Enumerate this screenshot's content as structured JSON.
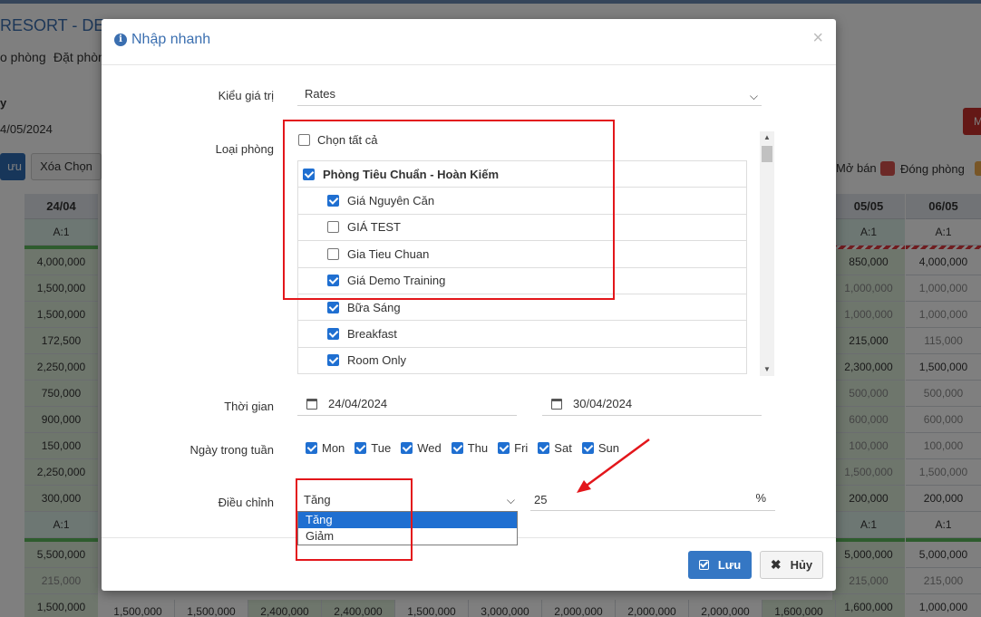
{
  "app": {
    "title": "RESORT - DEM",
    "nav": [
      "o phòng",
      "Đặt phòn"
    ],
    "filter_label": "y",
    "filter_date": "4/05/2024",
    "save_button": "ưu",
    "clear_button": "Xóa Chọn",
    "legend": [
      {
        "label": "Mở bán",
        "color": "#ffffff"
      },
      {
        "label": "Đóng phòng",
        "color": "#d9534f"
      }
    ],
    "columns": [
      {
        "date": "24/04",
        "avail": "A:1",
        "values": [
          "4,000,000",
          "1,500,000",
          "1,500,000",
          "172,500",
          "2,250,000",
          "750,000",
          "900,000",
          "150,000",
          "2,250,000",
          "300,000"
        ],
        "avail2": "A:1",
        "values2": [
          "5,500,000",
          "215,000",
          "1,500,000"
        ]
      },
      {
        "date": "05/05",
        "avail": "A:1",
        "values": [
          "850,000",
          "1,000,000",
          "1,000,000",
          "215,000",
          "2,300,000",
          "500,000",
          "600,000",
          "100,000",
          "1,500,000",
          "200,000"
        ],
        "avail2": "A:1",
        "values2": [
          "5,000,000",
          "215,000",
          "1,600,000"
        ]
      },
      {
        "date": "06/05",
        "avail": "A:1",
        "values": [
          "4,000,000",
          "1,000,000",
          "1,000,000",
          "115,000",
          "1,500,000",
          "500,000",
          "600,000",
          "100,000",
          "1,500,000",
          "200,000"
        ],
        "avail2": "A:1",
        "values2": [
          "5,000,000",
          "215,000",
          "1,000,000"
        ]
      }
    ],
    "bottom_row": [
      "1,500,000",
      "1,500,000",
      "2,400,000",
      "2,400,000",
      "1,500,000",
      "3,000,000",
      "2,000,000",
      "2,000,000",
      "2,000,000",
      "1,600,000"
    ]
  },
  "modal": {
    "title": "Nhập nhanh",
    "close": "×",
    "value_type_label": "Kiểu giá trị",
    "value_type": "Rates",
    "room_type_label": "Loại phòng",
    "select_all": "Chọn tất cả",
    "rooms": [
      {
        "label": "Phòng Tiêu Chuẩn - Hoàn Kiếm",
        "checked": true,
        "group": true
      },
      {
        "label": "Giá Nguyên Căn",
        "checked": true,
        "group": false
      },
      {
        "label": "GIÁ TEST",
        "checked": false,
        "group": false
      },
      {
        "label": "Gia Tieu Chuan",
        "checked": false,
        "group": false
      },
      {
        "label": "Giá Demo Training",
        "checked": true,
        "group": false
      },
      {
        "label": "Bữa Sáng",
        "checked": true,
        "group": false
      },
      {
        "label": "Breakfast",
        "checked": true,
        "group": false
      },
      {
        "label": "Room Only",
        "checked": true,
        "group": false
      }
    ],
    "time_label": "Thời gian",
    "date_from": "24/04/2024",
    "date_to": "30/04/2024",
    "weekdays_label": "Ngày trong tuần",
    "weekdays": [
      "Mon",
      "Tue",
      "Wed",
      "Thu",
      "Fri",
      "Sat",
      "Sun"
    ],
    "adjust_label": "Điều chỉnh",
    "adjust_value": "Tăng",
    "adjust_options": [
      "Tăng",
      "Giảm"
    ],
    "amount": "25",
    "unit": "%",
    "save_label": "Lưu",
    "cancel_label": "Hủy"
  },
  "colors": {
    "accent": "#3577c4",
    "annotation": "#e3161b",
    "checkbox": "#1f6fd1"
  }
}
